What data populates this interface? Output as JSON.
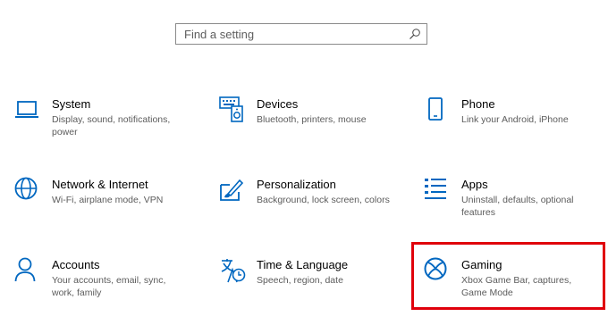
{
  "search": {
    "placeholder": "Find a setting",
    "icon": "search-icon"
  },
  "accent_color": "#0067c0",
  "highlight_color": "#e0000b",
  "tiles": [
    {
      "title": "System",
      "desc": "Display, sound, notifications, power",
      "icon": "laptop-icon"
    },
    {
      "title": "Devices",
      "desc": "Bluetooth, printers, mouse",
      "icon": "keyboard-speaker-icon"
    },
    {
      "title": "Phone",
      "desc": "Link your Android, iPhone",
      "icon": "phone-icon"
    },
    {
      "title": "Network & Internet",
      "desc": "Wi-Fi, airplane mode, VPN",
      "icon": "globe-icon"
    },
    {
      "title": "Personalization",
      "desc": "Background, lock screen, colors",
      "icon": "paintbrush-icon"
    },
    {
      "title": "Apps",
      "desc": "Uninstall, defaults, optional features",
      "icon": "apps-list-icon"
    },
    {
      "title": "Accounts",
      "desc": "Your accounts, email, sync, work, family",
      "icon": "person-icon"
    },
    {
      "title": "Time & Language",
      "desc": "Speech, region, date",
      "icon": "time-language-icon"
    },
    {
      "title": "Gaming",
      "desc": "Xbox Game Bar, captures, Game Mode",
      "icon": "xbox-icon"
    }
  ]
}
